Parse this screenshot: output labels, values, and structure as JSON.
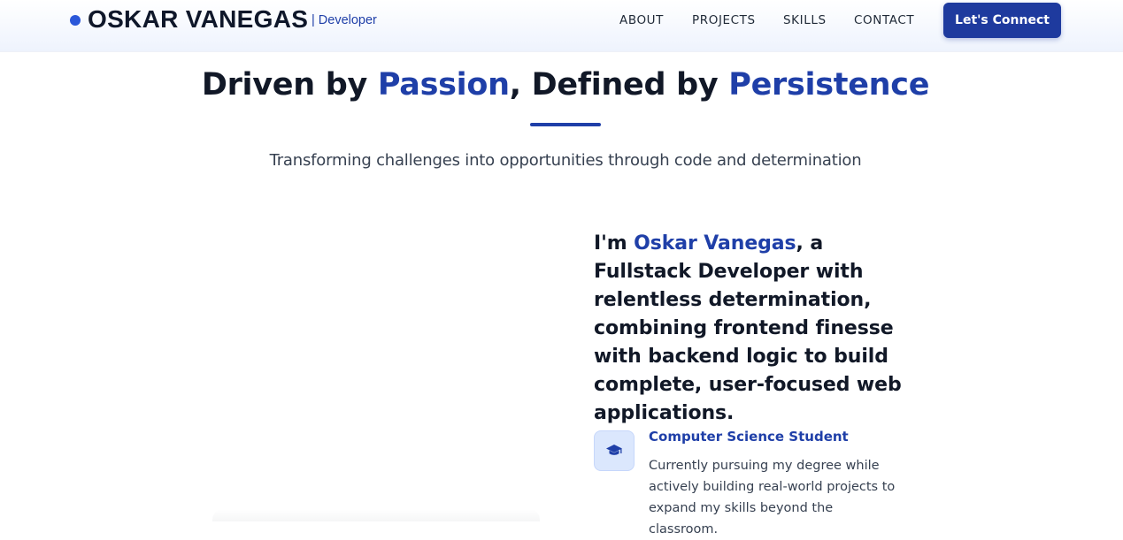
{
  "header": {
    "brand_name": "OSKAR VANEGAS",
    "brand_role": "| Developer",
    "nav": [
      "ABOUT",
      "PROJECTS",
      "SKILLS",
      "CONTACT"
    ],
    "cta_label": "Let's Connect"
  },
  "hero": {
    "title_part1": "Driven by ",
    "title_accent1": "Passion",
    "title_part2": ", Defined by ",
    "title_accent2": "Persistence",
    "subtitle": "Transforming challenges into opportunities through code and determination"
  },
  "about": {
    "intro_prefix": "I'm ",
    "intro_name": "Oskar Vanegas",
    "intro_rest": ", a Fullstack Developer with relentless determination, combining frontend finesse with backend logic to build complete, user-focused web applications.",
    "feature": {
      "icon": "graduation-cap-icon",
      "title": "Computer Science Student",
      "description": "Currently pursuing my degree while actively building real-world projects to expand my skills beyond the classroom."
    }
  },
  "colors": {
    "accent": "#1f3fa8",
    "cta_bg": "#1e3a9e",
    "brand_dot": "#2b57d9",
    "icon_box_bg": "#dbe7fd"
  }
}
